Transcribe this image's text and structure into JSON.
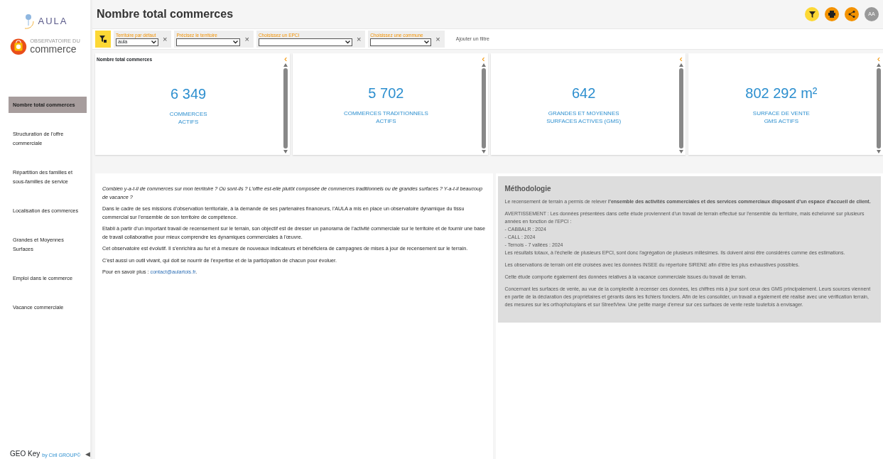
{
  "logos": {
    "aula": "AULA",
    "observatory_top": "OBSERVATOIRE DU",
    "observatory_name": "commerce"
  },
  "sidebar": {
    "items": [
      {
        "label": "Nombre total commerces",
        "selected": true
      },
      {
        "label": "Structuration de l’offre commerciale",
        "selected": false
      },
      {
        "label": "Répartition des familles et sous-familles de service",
        "selected": false
      },
      {
        "label": "Localisation des commerces",
        "selected": false
      },
      {
        "label": "Grandes et Moyennes Surfaces",
        "selected": false
      },
      {
        "label": "Emploi dans le commerce",
        "selected": false
      },
      {
        "label": "Vacance commerciale",
        "selected": false
      }
    ],
    "footer_brand": "GEO Key",
    "footer_by": "by Ciril GROUP©",
    "collapse_glyph": "◀"
  },
  "header": {
    "title": "Nombre total commerces",
    "avatar": "AA"
  },
  "filters": [
    {
      "label": "Territoire par défaut",
      "value": "aula",
      "remove": "×"
    },
    {
      "label": "Précisez le territoire",
      "remove": "×"
    },
    {
      "label": "Choisissez un EPCI",
      "remove": "×"
    },
    {
      "label": "Choisissez une commune",
      "remove": "×"
    }
  ],
  "add_filter": "Ajouter un filtre",
  "kpi_cards": [
    {
      "title": "Nombre total commerces",
      "value": "6 349",
      "caption": [
        "COMMERCES",
        "ACTIFS"
      ],
      "collapse": "‹"
    },
    {
      "value": "5 702",
      "caption": [
        "COMMERCES TRADITIONNELS",
        "ACTIFS"
      ],
      "collapse": "‹"
    },
    {
      "value": "642",
      "caption": [
        "GRANDES ET MOYENNES",
        "SURFACES ACTIVES (GMS)"
      ],
      "collapse": "‹"
    },
    {
      "value": "802 292 m²",
      "caption": [
        "SURFACE DE VENTE",
        "GMS ACTIFS"
      ],
      "collapse": "‹"
    }
  ],
  "intro": {
    "question": "Combien y-a-t-il de commerces sur mon territoire ? Où sont-ils ? L’offre est-elle plutôt composée de commerces traditionnels ou de grandes surfaces ? Y-a-t-il beaucoup de vacance ?",
    "paragraphs": [
      "Dans le cadre de ses missions d’observation territoriale, à la demande de ses partenaires financeurs, l’AULA a mis en place un observatoire dynamique du tissu commercial sur l’ensemble de son territoire de compétence.",
      "Etabli à partir d’un important travail de recensement sur le terrain, son objectif est de dresser un panorama de l’activité commerciale sur le territoire et de fournir une base de travail collaborative pour mieux comprendre les dynamiques commerciales à l’œuvre.",
      "Cet observatoire est évolutif. Il s’enrichira au fur et à mesure de nouveaux indicateurs et bénéficiera de campagnes de mises à jour de recensement sur le terrain.",
      "C’est aussi un outil vivant, qui doit se nourrir de l’expertise et de la participation de chacun pour évoluer."
    ],
    "contact_prefix": "Pour en savoir plus : ",
    "contact_link": "contact@aulartois.fr",
    "contact_suffix": "."
  },
  "methodology": {
    "title": "Méthodologie",
    "paragraphs": [
      [
        "Le recensement de terrain a permis de relever **l’ensemble des activités commerciales et des services commerciaux disposant d’un espace d’accueil de client.**"
      ],
      [
        "AVERTISSEMENT : Les données présentées dans cette étude proviennent d’un travail de terrain effectué sur l’ensemble du territoire, mais échelonné sur plusieurs années en fonction de l'EPCI :",
        "- CABBALR : 2024",
        "- CALL : 2024",
        "- Ternois - 7 vallées : 2024",
        "Les résultats totaux, à l'échelle de plusieurs EPCI, sont donc l'agrégation de plusieurs millésimes. Ils doivent ainsi être considérés comme des estimations."
      ],
      [
        "Les observations de terrain ont été croisées avec les données INSEE du répertoire SIRENE afin d'être les plus exhaustives possibles."
      ],
      [
        "Cette étude comporte également des données relatives à la vacance commerciale issues du travail de terrain."
      ],
      [
        "Concernant les surfaces de vente, au vue de la complexité à recenser ces données, les chiffres mis à jour sont ceux des GMS principalement. Leurs sources viennent en partie de la déclaration des propriétaires et gérants dans les fichiers fonciers. Afin de les consolider, un travail a également été réalisé avec une vérification terrain, des mesures sur les orthophotoplans et sur StreetView. Une petite marge d'erreur sur ces surfaces de vente reste toutefois à envisager."
      ]
    ]
  }
}
